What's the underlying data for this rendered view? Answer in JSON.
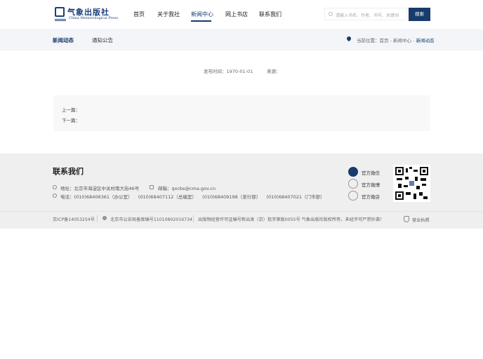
{
  "header": {
    "logo_text": "气象出版社",
    "logo_en": "China Meteorological Press",
    "nav": [
      "首页",
      "关于我社",
      "新闻中心",
      "网上书店",
      "联系我们"
    ],
    "active_nav": "新闻中心",
    "search_placeholder": "请输入书名、作者、书号、关键词",
    "search_button": "搜索"
  },
  "subnav": {
    "tabs": [
      "新闻动态",
      "通知公告"
    ],
    "breadcrumb_prefix": "当前位置：",
    "breadcrumb": [
      "首页",
      "新闻中心",
      "新闻动态"
    ],
    "sep": " - "
  },
  "article": {
    "publish_label": "发布时间：",
    "publish_date": "1970-01-01",
    "source_label": "来源：",
    "prev_label": "上一篇：",
    "next_label": "下一篇："
  },
  "footer": {
    "title": "联系我们",
    "address": "地址：北京市海淀区中关村南大街46号",
    "email_label": "邮箱：",
    "email": "qxcbs@cma.gov.cn",
    "phone_label": "电话：",
    "phones": [
      "(010)68406361（办公室）",
      "(010)68407112（总编室）",
      "(010)68409198（发行部）",
      "(010)68407021（门市部）"
    ],
    "social": [
      "官方微信",
      "官方微博",
      "官方微店"
    ],
    "icp": "京ICP备14053254号",
    "police": "北京市公安局备案编号11010802016734",
    "license": "出版物经营许可证编号新出发（京）批字第版0055号 气象出版社版权所有，未经许可严禁抄袭！",
    "business_license": "营业执照"
  },
  "colors": {
    "brand": "#163c6c",
    "footer_bg": "#efefef",
    "subnav_bg": "#f3f5f8"
  }
}
